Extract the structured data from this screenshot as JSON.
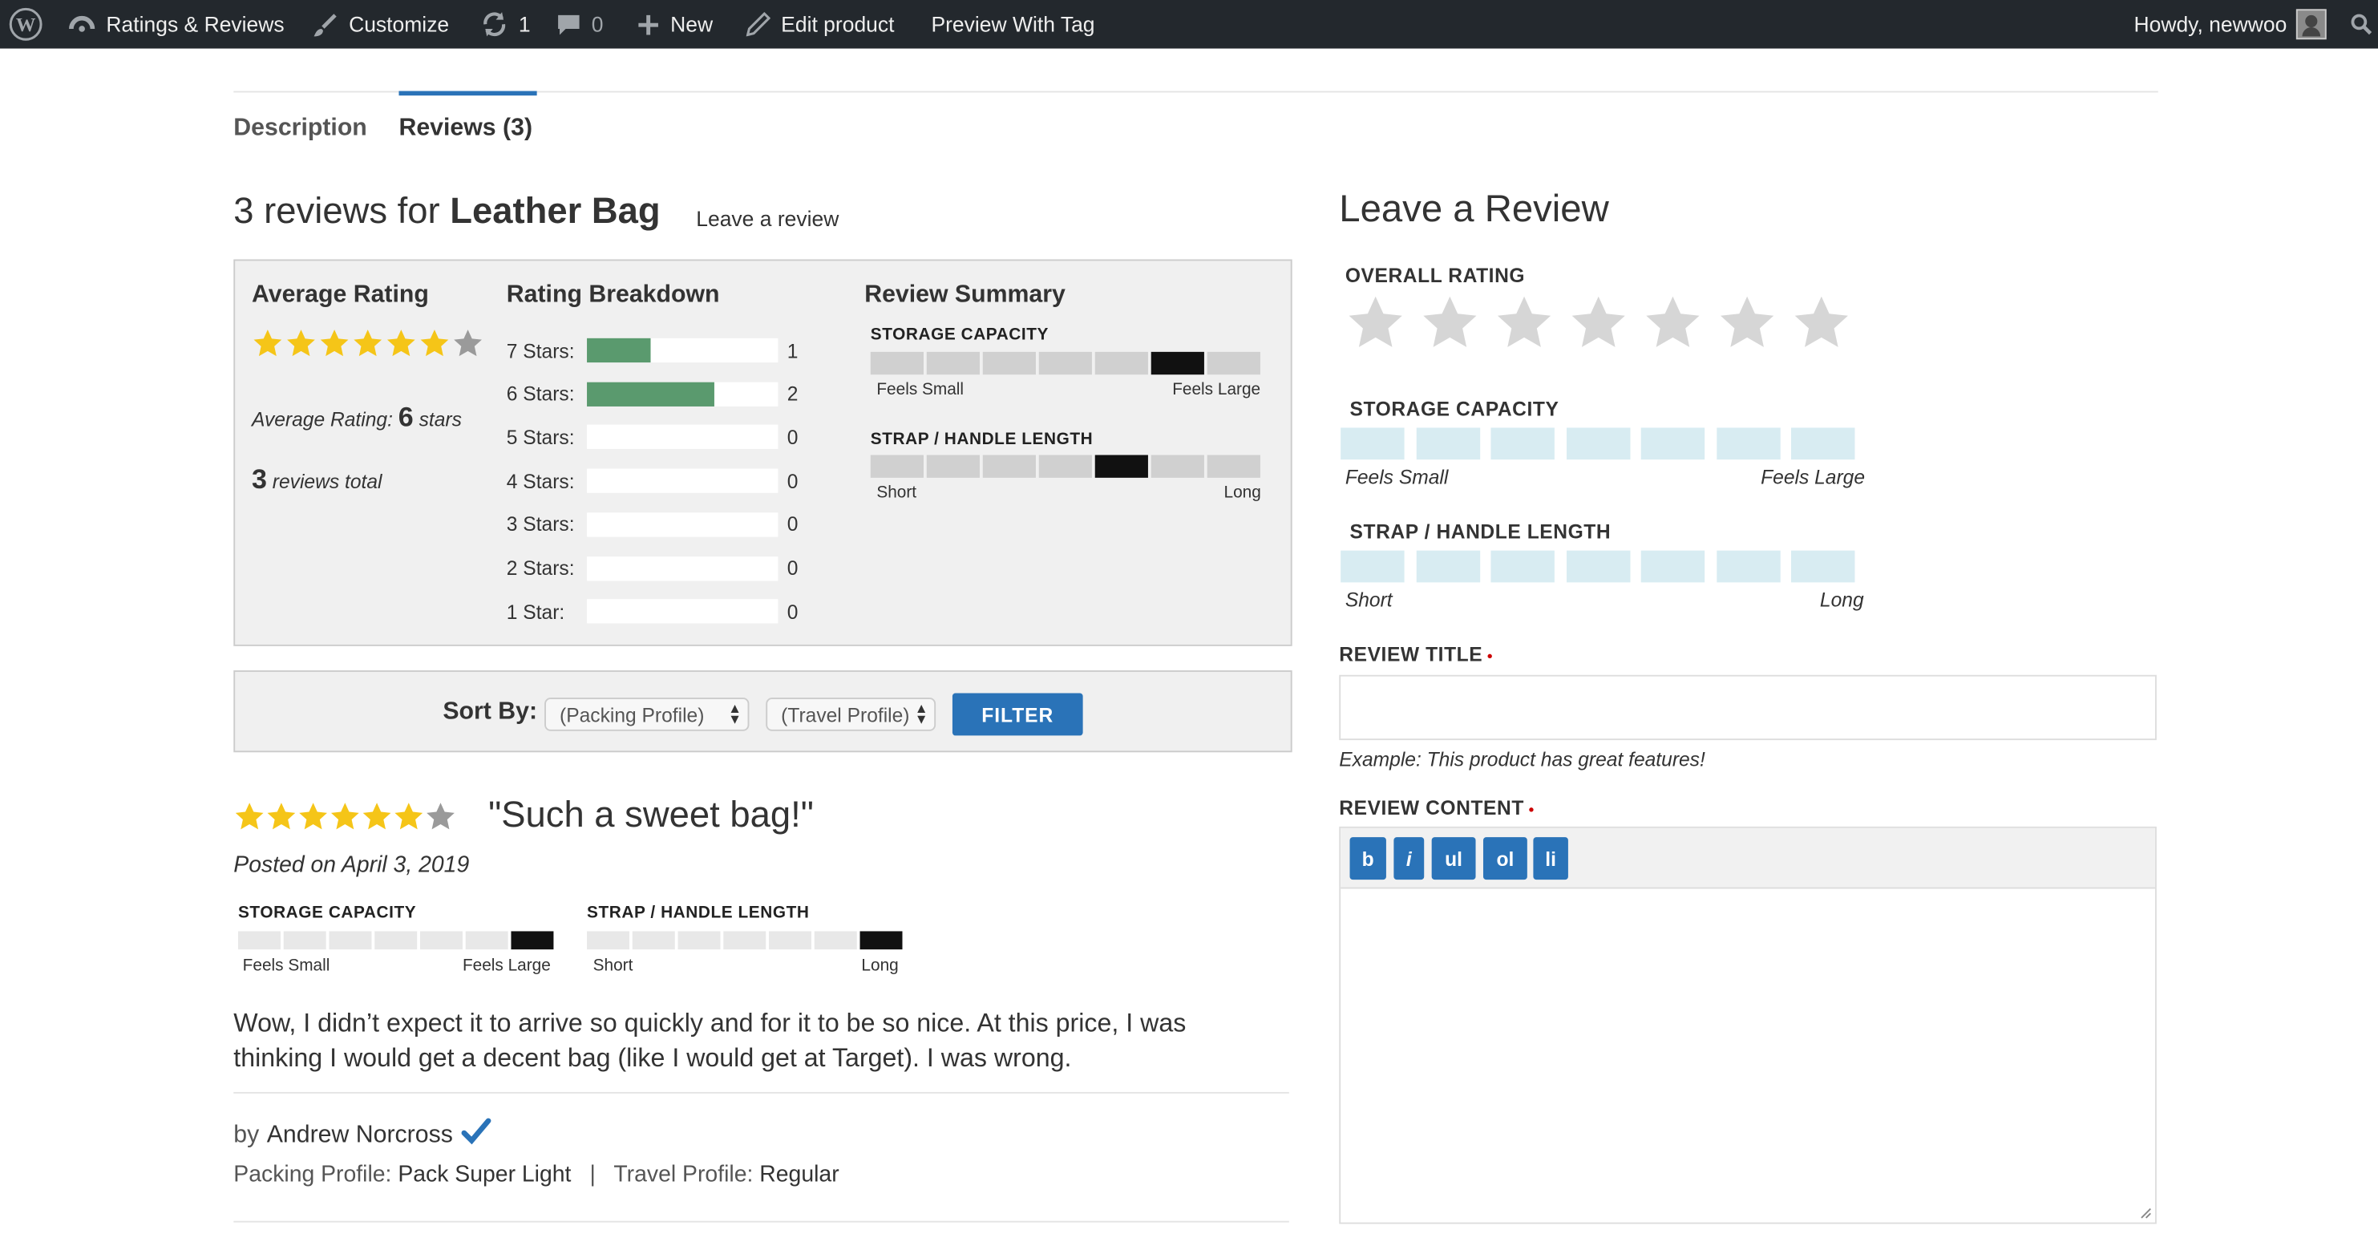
{
  "admin_bar": {
    "site_label": "Ratings & Reviews",
    "customize_label": "Customize",
    "updates_count": "1",
    "comments_count": "0",
    "new_label": "New",
    "edit_label": "Edit product",
    "preview_label": "Preview With Tag",
    "howdy_label": "Howdy, newwoo"
  },
  "tabs": [
    {
      "label": "Description",
      "active": false
    },
    {
      "label": "Reviews (3)",
      "active": true
    }
  ],
  "reviews": {
    "heading_prefix": "3 reviews for",
    "product_name": "Leather Bag",
    "leave_link": "Leave a review"
  },
  "summary": {
    "avg_heading": "Average Rating",
    "avg_stars_filled": 6,
    "avg_stars_total": 7,
    "avg_prefix": "Average Rating:",
    "avg_value": "6",
    "avg_suffix": "stars",
    "total_count": "3",
    "total_suffix": "reviews total",
    "breakdown_heading": "Rating Breakdown",
    "breakdown": [
      {
        "label": "7 Stars:",
        "count": "1",
        "fraction": 0.333
      },
      {
        "label": "6 Stars:",
        "count": "2",
        "fraction": 0.667
      },
      {
        "label": "5 Stars:",
        "count": "0",
        "fraction": 0
      },
      {
        "label": "4 Stars:",
        "count": "0",
        "fraction": 0
      },
      {
        "label": "3 Stars:",
        "count": "0",
        "fraction": 0
      },
      {
        "label": "2 Stars:",
        "count": "0",
        "fraction": 0
      },
      {
        "label": "1 Star:",
        "count": "0",
        "fraction": 0
      }
    ],
    "review_summary_heading": "Review Summary",
    "scales": [
      {
        "name": "STORAGE CAPACITY",
        "low": "Feels Small",
        "high": "Feels Large",
        "selected": 6,
        "segments": 7
      },
      {
        "name": "STRAP / HANDLE LENGTH",
        "low": "Short",
        "high": "Long",
        "selected": 5,
        "segments": 7
      }
    ]
  },
  "sort": {
    "label": "Sort By:",
    "packing_select": "(Packing Profile)",
    "travel_select": "(Travel Profile)",
    "filter_button": "FILTER"
  },
  "review": {
    "stars_filled": 6,
    "stars_total": 7,
    "title": "\"Such a sweet bag!\"",
    "posted": "Posted on April 3, 2019",
    "scales": [
      {
        "name": "STORAGE CAPACITY",
        "low": "Feels Small",
        "high": "Feels Large",
        "selected": 7
      },
      {
        "name": "STRAP / HANDLE LENGTH",
        "low": "Short",
        "high": "Long",
        "selected": 7
      }
    ],
    "body": "Wow, I didn’t expect it to arrive so quickly and for it to be so nice. At this price, I was thinking I would get a decent bag (like I would get at Target). I was wrong.",
    "by_prefix": "by",
    "author": "Andrew Norcross",
    "packing_label": "Packing Profile:",
    "packing_value": "Pack Super Light",
    "separator": "|",
    "travel_label": "Travel Profile:",
    "travel_value": "Regular"
  },
  "form": {
    "title": "Leave a Review",
    "overall_label": "OVERALL RATING",
    "overall_stars_total": 7,
    "storage_label": "STORAGE CAPACITY",
    "storage_low": "Feels Small",
    "storage_high": "Feels Large",
    "strap_label": "STRAP / HANDLE LENGTH",
    "strap_low": "Short",
    "strap_high": "Long",
    "review_title_label": "REVIEW TITLE",
    "review_title_value": "",
    "required_mark": "•",
    "example": "Example: This product has great features!",
    "review_content_label": "REVIEW CONTENT",
    "toolbar": [
      "b",
      "i",
      "ul",
      "ol",
      "li"
    ]
  },
  "colors": {
    "star_filled": "#f5c518",
    "star_empty": "#9a9a9a",
    "star_form": "#d6d6d6",
    "accent": "#2a73b8",
    "bar_fill": "#5a9a6e"
  }
}
